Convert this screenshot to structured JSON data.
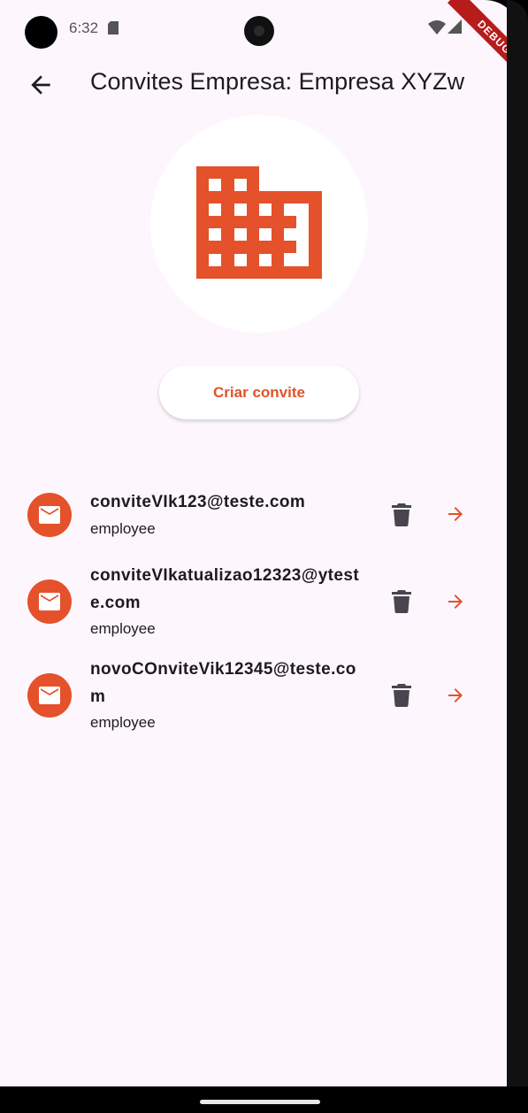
{
  "status_bar": {
    "time": "6:32",
    "debug_label": "DEBUG"
  },
  "app_bar": {
    "title": "Convites Empresa: Empresa XYZw"
  },
  "actions": {
    "create_invite_label": "Criar convite"
  },
  "invites": [
    {
      "email": "conviteVIk123@teste.com",
      "role": "employee"
    },
    {
      "email": "conviteVIkatualizao12323@yteste.com",
      "role": "employee"
    },
    {
      "email": "novoCOnviteVik12345@teste.com",
      "role": "employee"
    }
  ],
  "colors": {
    "accent": "#e4512a",
    "background": "#fdf7fd",
    "icon_gray": "#49454f"
  },
  "icons": [
    "back-arrow-icon",
    "building-icon",
    "email-icon",
    "trash-icon",
    "arrow-forward-icon"
  ]
}
